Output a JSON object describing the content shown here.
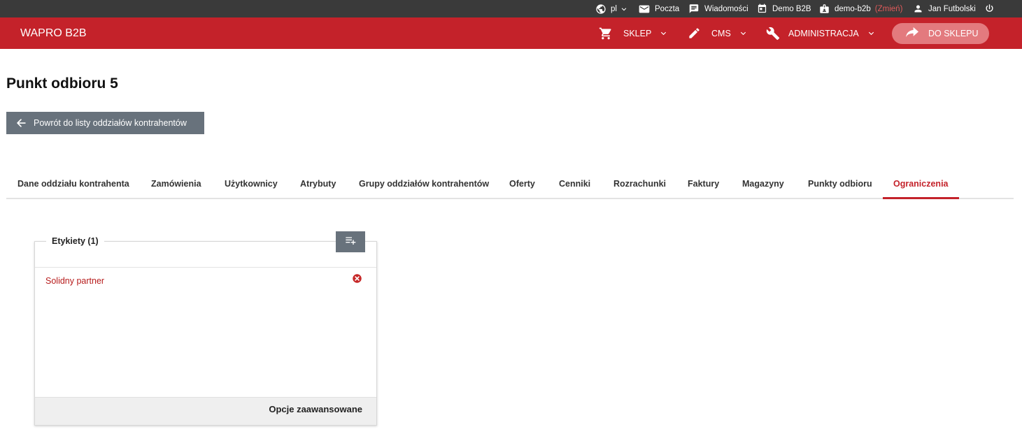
{
  "topbar": {
    "language": "pl",
    "mail": "Poczta",
    "messages": "Wiadomości",
    "company": "Demo B2B",
    "account": "demo-b2b",
    "change": "(Zmień)",
    "user": "Jan Futbolski"
  },
  "header": {
    "brand": "WAPRO B2B",
    "nav": [
      {
        "label": "SKLEP",
        "icon": "cart-icon"
      },
      {
        "label": "CMS",
        "icon": "pencil-icon"
      },
      {
        "label": "ADMINISTRACJA",
        "icon": "wrench-icon"
      }
    ],
    "shop_button": "DO SKLEPU"
  },
  "page": {
    "title": "Punkt odbioru 5",
    "back_button": "Powrót do listy oddziałów kontrahentów"
  },
  "tabs": [
    {
      "label": "Dane oddziału kontrahenta",
      "active": false
    },
    {
      "label": "Zamówienia",
      "active": false
    },
    {
      "label": "Użytkownicy",
      "active": false
    },
    {
      "label": "Atrybuty",
      "active": false
    },
    {
      "label": "Grupy oddziałów kontrahentów",
      "active": false
    },
    {
      "label": "Oferty",
      "active": false
    },
    {
      "label": "Cenniki",
      "active": false
    },
    {
      "label": "Rozrachunki",
      "active": false
    },
    {
      "label": "Faktury",
      "active": false
    },
    {
      "label": "Magazyny",
      "active": false
    },
    {
      "label": "Punkty odbioru",
      "active": false
    },
    {
      "label": "Ograniczenia",
      "active": true
    }
  ],
  "labels_card": {
    "title": "Etykiety (1)",
    "items": [
      "Solidny partner"
    ],
    "advanced_options": "Opcje zaawansowane"
  },
  "colors": {
    "brand_red": "#c4222a",
    "topbar_dark": "#3a3a3a",
    "button_gray": "#68727c",
    "shop_button_pink": "#e37a7e",
    "tag_red": "#b71c1c"
  }
}
